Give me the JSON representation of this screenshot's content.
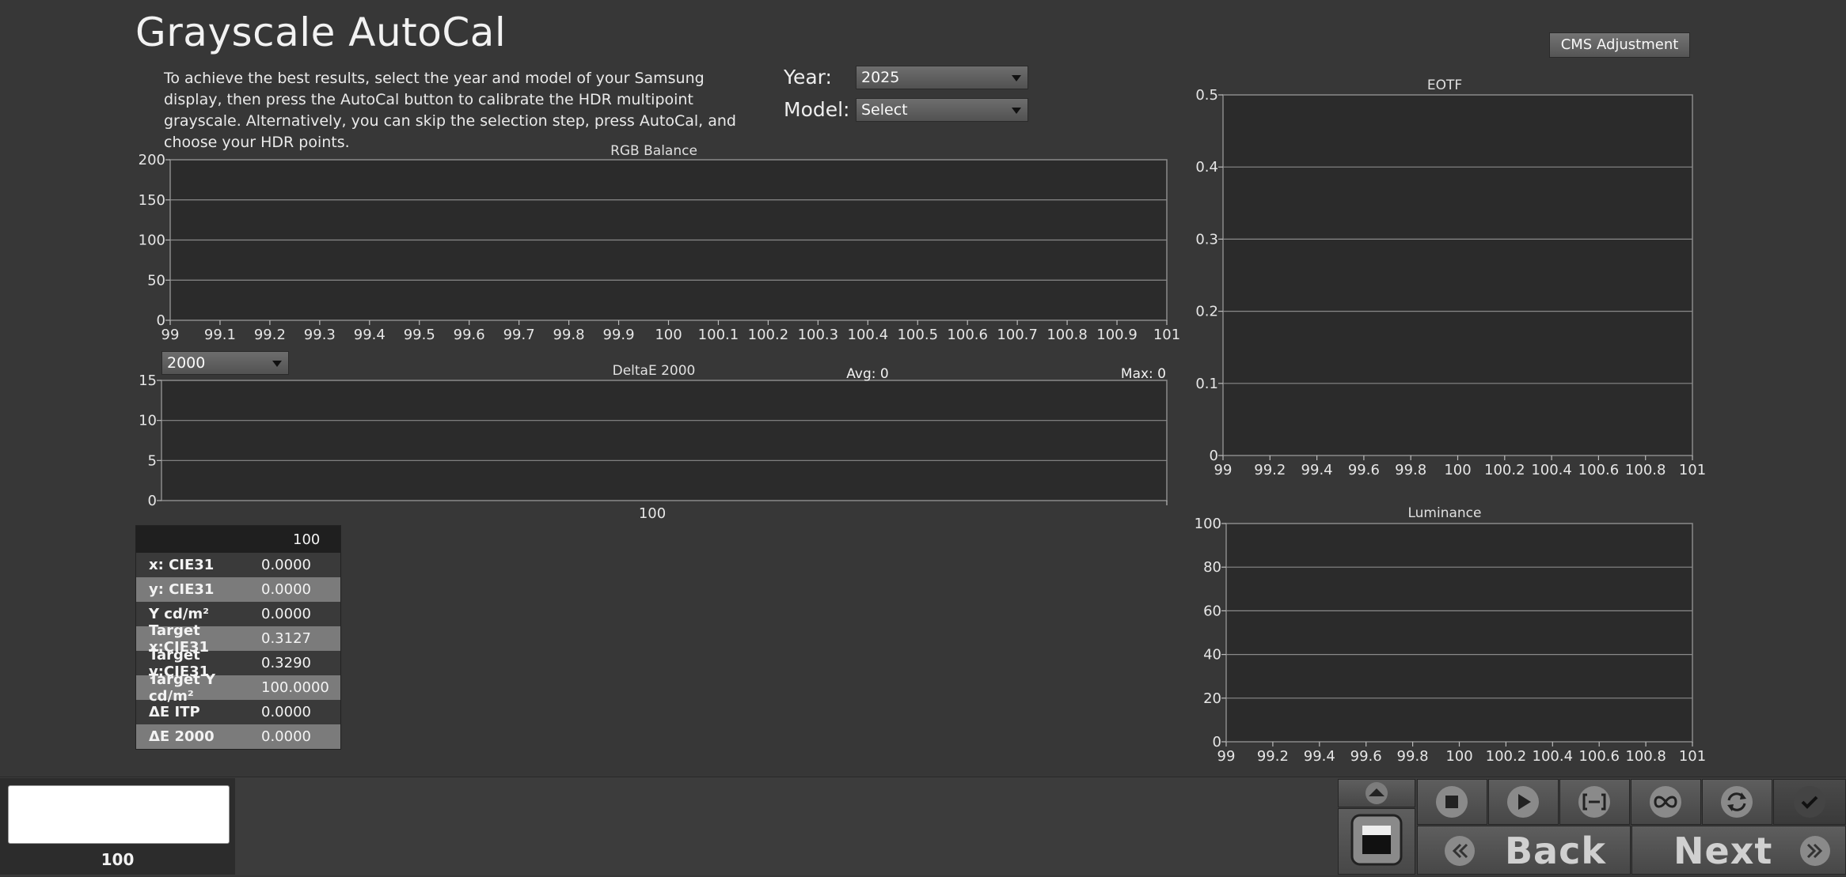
{
  "page": {
    "title": "Grayscale AutoCal",
    "intro": "To achieve the best results, select the year and model of your Samsung display, then press the AutoCal button to calibrate the HDR multipoint grayscale. Alternatively, you can skip the selection step, press AutoCal, and choose your HDR points.",
    "year_label": "Year:",
    "year_value": "2025",
    "model_label": "Model:",
    "model_value": "Select",
    "cms_button": "CMS Adjustment",
    "deltae_select": "2000",
    "avg_text": "Avg: 0",
    "max_text": "Max: 0"
  },
  "table": {
    "header": "100",
    "rows": [
      {
        "label": "x: CIE31",
        "value": "0.0000"
      },
      {
        "label": "y: CIE31",
        "value": "0.0000"
      },
      {
        "label": "Y cd/m²",
        "value": "0.0000"
      },
      {
        "label": "Target x:CIE31",
        "value": "0.3127"
      },
      {
        "label": "Target y:CIE31",
        "value": "0.3290"
      },
      {
        "label": "Target Y cd/m²",
        "value": "100.0000"
      },
      {
        "label": "ΔE ITP",
        "value": "0.0000"
      },
      {
        "label": "ΔE 2000",
        "value": "0.0000"
      }
    ]
  },
  "bottom": {
    "panel_value": "100",
    "back_label": "Back",
    "next_label": "Next"
  },
  "colors": {
    "background": "#373737",
    "plot_area": "#2b2b2b",
    "gridline": "#8a8a8a"
  },
  "chart_data": [
    {
      "type": "line",
      "title": "RGB Balance",
      "xlim": [
        99,
        101
      ],
      "ylim": [
        0,
        200
      ],
      "x_ticks": [
        "99",
        "99.1",
        "99.2",
        "99.3",
        "99.4",
        "99.5",
        "99.6",
        "99.7",
        "99.8",
        "99.9",
        "100",
        "100.1",
        "100.2",
        "100.3",
        "100.4",
        "100.5",
        "100.6",
        "100.7",
        "100.8",
        "100.9",
        "101"
      ],
      "y_ticks": [
        "0",
        "50",
        "100",
        "150",
        "200"
      ],
      "series": []
    },
    {
      "type": "bar",
      "title": "DeltaE 2000",
      "categories": [
        "100"
      ],
      "ylim": [
        0,
        15
      ],
      "y_ticks": [
        "0",
        "5",
        "10",
        "15"
      ],
      "series": []
    },
    {
      "type": "line",
      "title": "EOTF",
      "xlim": [
        99,
        101
      ],
      "ylim": [
        0,
        0.5
      ],
      "x_ticks": [
        "99",
        "99.2",
        "99.4",
        "99.6",
        "99.8",
        "100",
        "100.2",
        "100.4",
        "100.6",
        "100.8",
        "101"
      ],
      "y_ticks": [
        "0",
        "0.1",
        "0.2",
        "0.3",
        "0.4",
        "0.5"
      ],
      "series": []
    },
    {
      "type": "line",
      "title": "Luminance",
      "xlim": [
        99,
        101
      ],
      "ylim": [
        0,
        100
      ],
      "x_ticks": [
        "99",
        "99.2",
        "99.4",
        "99.6",
        "99.8",
        "100",
        "100.2",
        "100.4",
        "100.6",
        "100.8",
        "101"
      ],
      "y_ticks": [
        "0",
        "20",
        "40",
        "60",
        "80",
        "100"
      ],
      "series": []
    }
  ]
}
